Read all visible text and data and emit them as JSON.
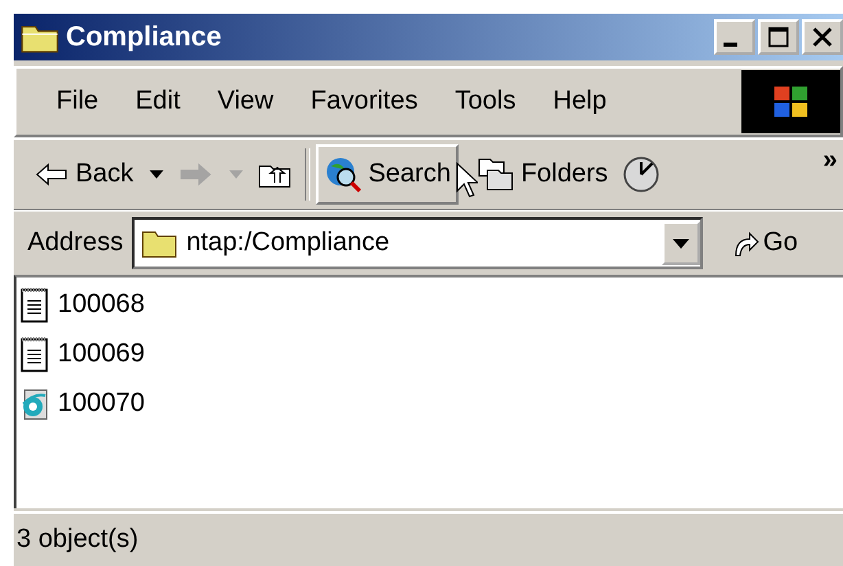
{
  "window": {
    "title": "Compliance"
  },
  "menu": [
    "File",
    "Edit",
    "View",
    "Favorites",
    "Tools",
    "Help"
  ],
  "toolbar": [
    {
      "kind": "back",
      "label": "Back",
      "disabled": false,
      "hot": false
    },
    {
      "kind": "forward",
      "disabled": true,
      "hot": false
    },
    {
      "kind": "up",
      "disabled": false,
      "hot": false
    },
    {
      "kind": "search",
      "label": "Search",
      "disabled": false,
      "hot": true
    },
    {
      "kind": "folders",
      "label": "Folders",
      "disabled": false,
      "hot": false
    },
    {
      "kind": "history",
      "disabled": false,
      "hot": false
    }
  ],
  "toolbar_overflow": "»",
  "address": {
    "label": "Address",
    "value": "ntap:/Compliance",
    "go": "Go"
  },
  "files": [
    {
      "kind": "text",
      "name": "100068"
    },
    {
      "kind": "text",
      "name": "100069"
    },
    {
      "kind": "html",
      "name": "100070"
    }
  ],
  "status_bar": "3 object(s)"
}
